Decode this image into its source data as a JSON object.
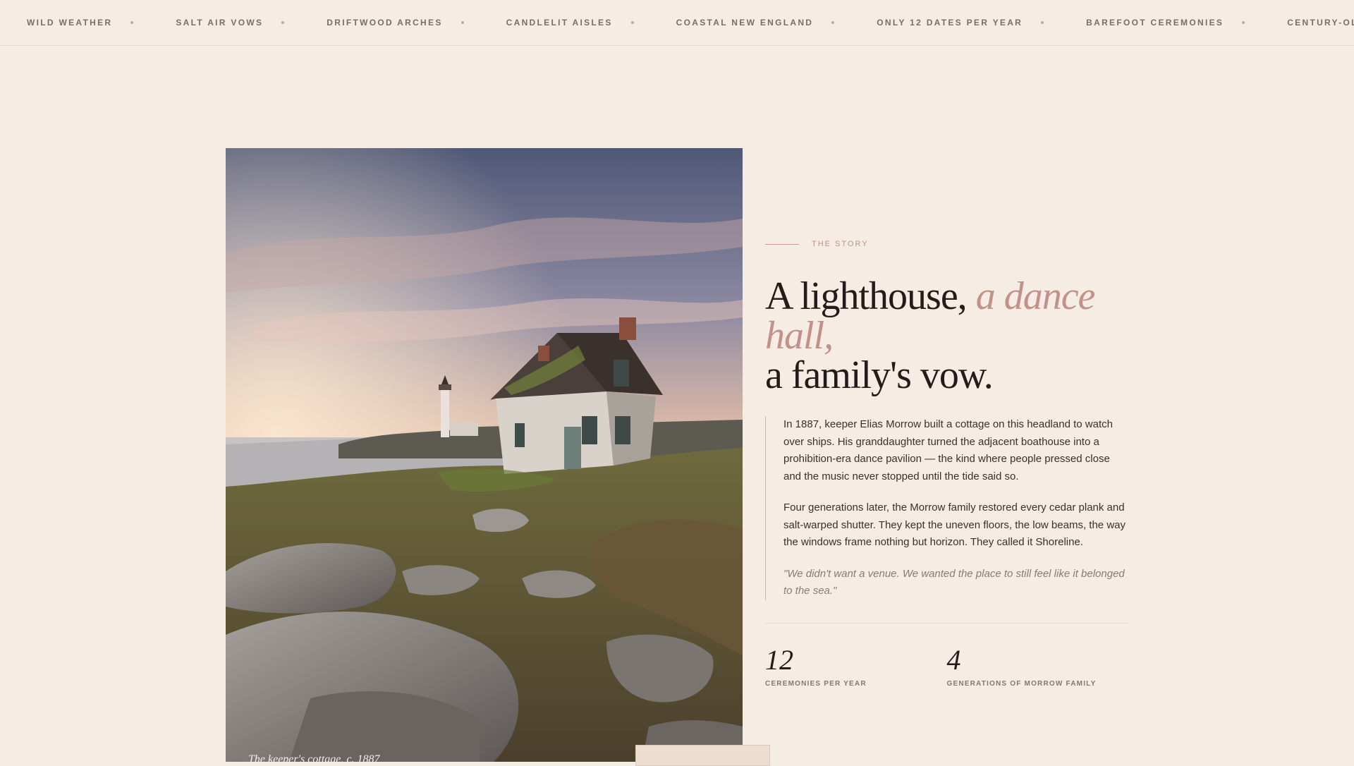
{
  "marquee": {
    "items": [
      "WILD WEATHER",
      "SALT AIR VOWS",
      "DRIFTWOOD ARCHES",
      "CANDLELIT AISLES",
      "COASTAL NEW ENGLAND",
      "ONLY 12 DATES PER YEAR",
      "BAREFOOT CEREMONIES",
      "CENTURY-OLD SHORE"
    ]
  },
  "photo": {
    "caption": "The keeper's cottage, c. 1887"
  },
  "story": {
    "eyebrow": "THE STORY",
    "headline": {
      "part1": "A lighthouse, ",
      "accent": "a dance hall,",
      "part2": "a family's vow."
    },
    "paragraphs": [
      "In 1887, keeper Elias Morrow built a cottage on this headland to watch over ships. His granddaughter turned the adjacent boathouse into a prohibition-era dance pavilion — the kind where people pressed close and the music never stopped until the tide said so.",
      "Four generations later, the Morrow family restored every cedar plank and salt-warped shutter. They kept the uneven floors, the low beams, the way the windows frame nothing but horizon. They called it Shoreline."
    ],
    "quote": "\"We didn't want a venue. We wanted the place to still feel like it belonged to the sea.\"",
    "stats": [
      {
        "number": "12",
        "caption": "CEREMONIES PER YEAR"
      },
      {
        "number": "4",
        "caption": "GENERATIONS OF MORROW FAMILY"
      }
    ]
  },
  "colors": {
    "background": "#f5ece3",
    "accent": "#c2918a",
    "text": "#231c1a"
  }
}
